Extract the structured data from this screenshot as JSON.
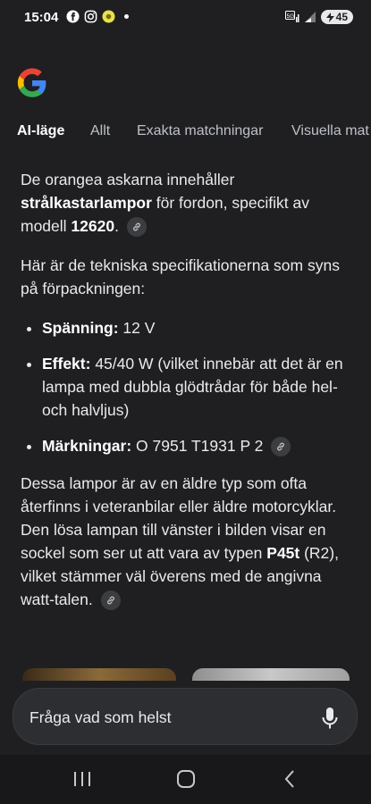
{
  "status_bar": {
    "time": "15:04",
    "left_icons": [
      "facebook-icon",
      "instagram-icon",
      "sun-icon"
    ],
    "right_icons": [
      "signal-5g-icon",
      "wifi-signal-icon"
    ],
    "battery": "45"
  },
  "tabs": [
    {
      "label": "AI-läge",
      "active": true
    },
    {
      "label": "Allt"
    },
    {
      "label": "Exakta matchningar"
    },
    {
      "label": "Visuella mat"
    }
  ],
  "answer": {
    "p1_a": "De orangea askarna innehåller ",
    "p1_b": "strålkastarlampor",
    "p1_c": " för fordon, specifikt av modell ",
    "p1_d": "12620",
    "p1_e": ".",
    "p2": "Här är de tekniska specifikationerna som syns på förpackningen:",
    "specs": [
      {
        "label": "Spänning:",
        "value": " 12 V"
      },
      {
        "label": "Effekt:",
        "value": " 45/40 W (vilket innebär att det är en lampa med dubbla glödtrådar för både hel- och halvljus)"
      },
      {
        "label": "Märkningar:",
        "value": " O 7951 T1931 P 2"
      }
    ],
    "p3_a": "Dessa lampor är av en äldre typ som ofta återfinns i veteranbilar eller äldre motorcyklar. Den lösa lampan till vänster i bilden visar en sockel som ser ut att vara av typen ",
    "p3_b": "P45t",
    "p3_c": " (R2), vilket stämmer väl överens med de angivna watt-talen."
  },
  "ask": {
    "placeholder": "Fråga vad som helst"
  },
  "nav": [
    "recents-icon",
    "home-icon",
    "back-icon"
  ]
}
